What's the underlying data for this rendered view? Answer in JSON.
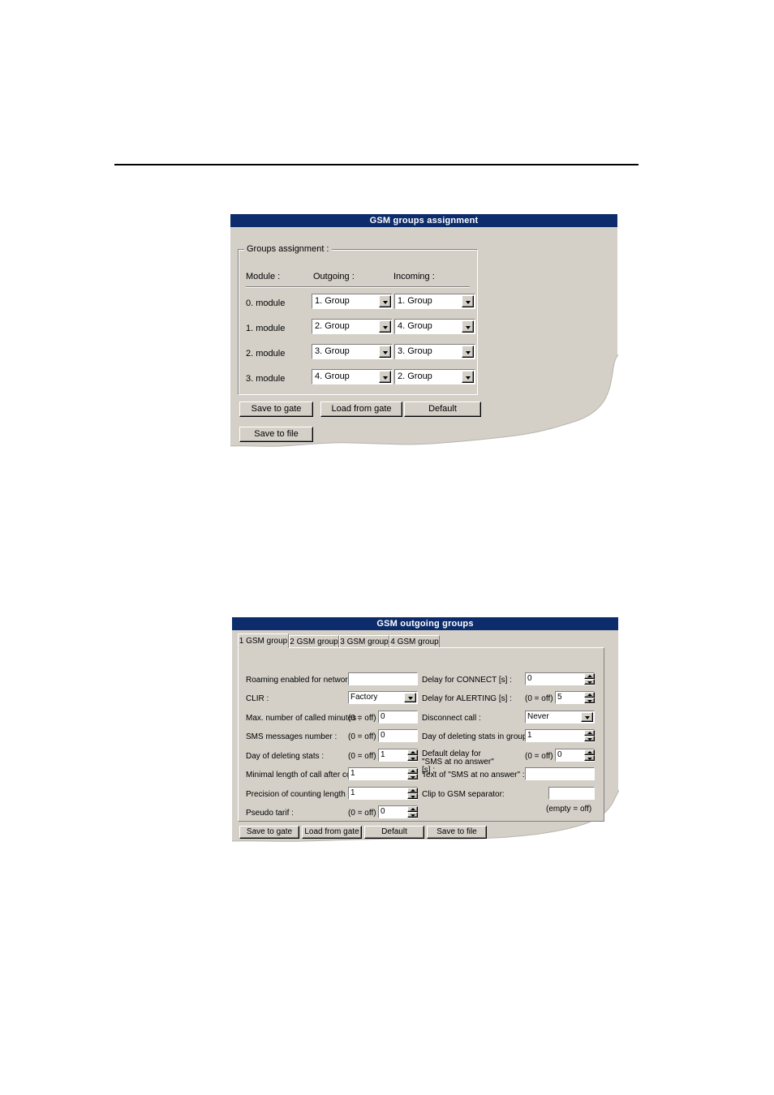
{
  "dialog1": {
    "title": "GSM groups assignment",
    "groupbox_title": "Groups assignment :",
    "columns": {
      "module": "Module :",
      "outgoing": "Outgoing :",
      "incoming": "Incoming :"
    },
    "rows": [
      {
        "module": "0. module",
        "outgoing": "1. Group",
        "incoming": "1. Group"
      },
      {
        "module": "1. module",
        "outgoing": "2. Group",
        "incoming": "4. Group"
      },
      {
        "module": "2. module",
        "outgoing": "3. Group",
        "incoming": "3. Group"
      },
      {
        "module": "3. module",
        "outgoing": "4. Group",
        "incoming": "2. Group"
      }
    ],
    "buttons": {
      "save_to_gate": "Save to gate",
      "load_from_gate": "Load from gate",
      "default": "Default",
      "save_to_file": "Save to file"
    }
  },
  "dialog2": {
    "title": "GSM outgoing groups",
    "tabs": [
      {
        "label": "1 GSM group",
        "active": true
      },
      {
        "label": "2 GSM group",
        "active": false
      },
      {
        "label": "3 GSM group",
        "active": false
      },
      {
        "label": "4 GSM group",
        "active": false
      }
    ],
    "left_fields": {
      "roaming": {
        "label": "Roaming enabled for network :",
        "value": ""
      },
      "clir": {
        "label": "CLIR :",
        "value": "Factory"
      },
      "max_minutes": {
        "label": "Max. number of called minutes :",
        "hint": "(0 = off)",
        "value": "0"
      },
      "sms_number": {
        "label": "SMS messages number :",
        "hint": "(0 = off)",
        "value": "0"
      },
      "day_delete_stats": {
        "label": "Day of deleting stats :",
        "hint": "(0 = off)",
        "value": "1"
      },
      "min_length": {
        "label": "Minimal length of call after connect :",
        "value": "1"
      },
      "precision": {
        "label": "Precision of counting length of call :",
        "value": "1"
      },
      "pseudo_tarif": {
        "label": "Pseudo tarif :",
        "hint": "(0 = off)",
        "value": "0"
      }
    },
    "right_fields": {
      "delay_connect": {
        "label": "Delay for CONNECT [s] :",
        "value": "0"
      },
      "delay_alerting": {
        "label": "Delay for ALERTING [s] :",
        "hint": "(0 = off)",
        "value": "5"
      },
      "disconnect_call": {
        "label": "Disconnect call :",
        "value": "Never"
      },
      "day_delete_group": {
        "label": "Day of deleting stats in group :",
        "value": "1"
      },
      "default_delay_sms": {
        "label": "Default delay for \"SMS at no answer\" [s] :",
        "hint": "(0 = off)",
        "value": "0"
      },
      "text_sms": {
        "label": "Text of \"SMS at no answer\" :",
        "value": ""
      },
      "clip_separator": {
        "label": "Clip to GSM separator:",
        "value": ""
      },
      "empty_note": "(empty = off)"
    },
    "buttons": {
      "save_to_gate": "Save to gate",
      "load_from_gate": "Load from gate",
      "default": "Default",
      "save_to_file": "Save to file"
    }
  },
  "colors": {
    "titlebar": "#0d2c6b",
    "dialog_face": "#d4d0c8",
    "field_bg": "#ffffff",
    "shadow": "#808080"
  }
}
